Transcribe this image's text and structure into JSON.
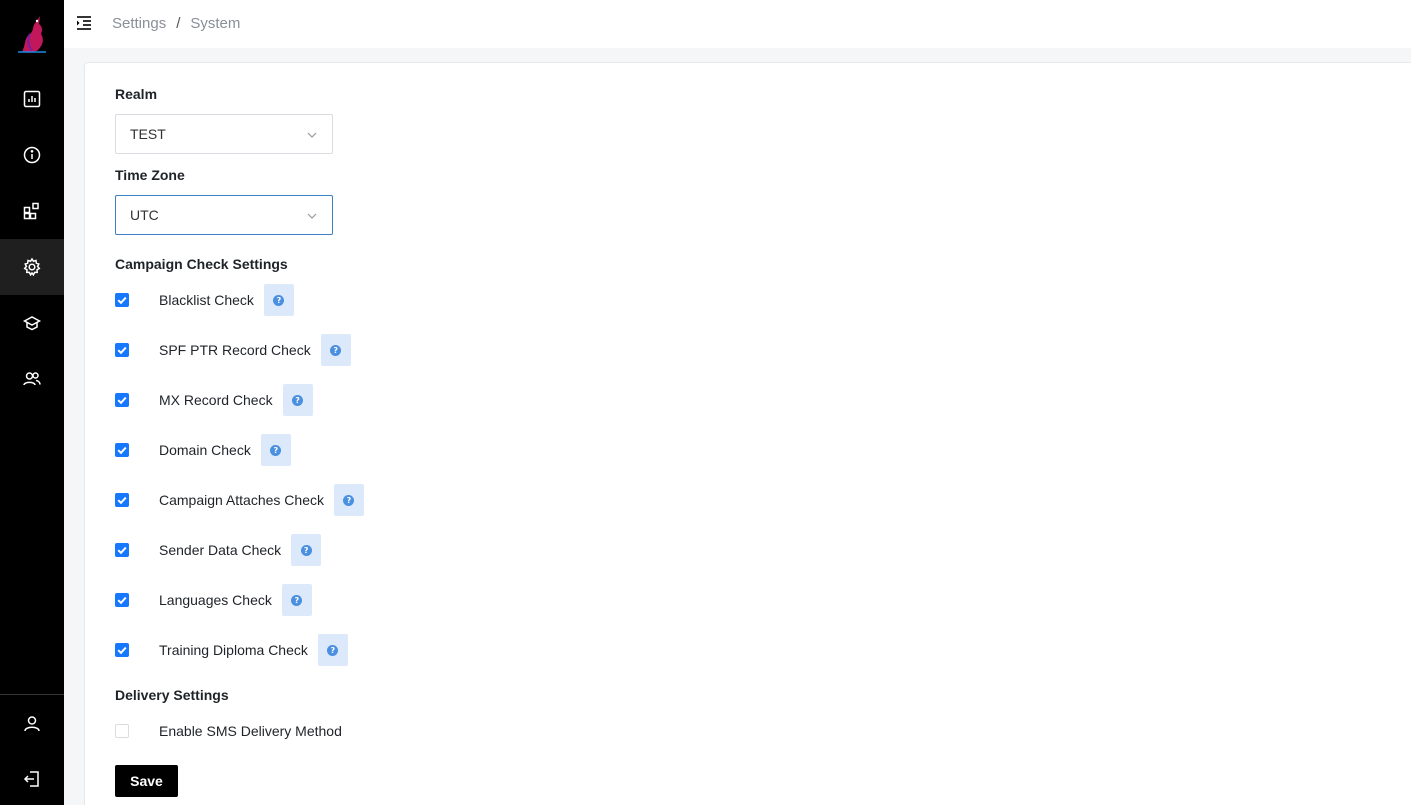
{
  "breadcrumb": {
    "parent": "Settings",
    "separator": "/",
    "current": "System"
  },
  "form": {
    "realm_label": "Realm",
    "realm_value": "TEST",
    "timezone_label": "Time Zone",
    "timezone_value": "UTC",
    "campaign_section_title": "Campaign Check Settings",
    "checks": [
      {
        "label": "Blacklist Check",
        "checked": true
      },
      {
        "label": "SPF PTR Record Check",
        "checked": true
      },
      {
        "label": "MX Record Check",
        "checked": true
      },
      {
        "label": "Domain Check",
        "checked": true
      },
      {
        "label": "Campaign Attaches Check",
        "checked": true
      },
      {
        "label": "Sender Data Check",
        "checked": true
      },
      {
        "label": "Languages Check",
        "checked": true
      },
      {
        "label": "Training Diploma Check",
        "checked": true
      }
    ],
    "delivery_section_title": "Delivery Settings",
    "sms_label": "Enable SMS Delivery Method",
    "sms_checked": false,
    "save_label": "Save"
  },
  "help_glyph": "?",
  "sidebar": {
    "items": [
      "dashboard-icon",
      "info-icon",
      "modules-icon",
      "settings-icon",
      "training-icon",
      "users-icon"
    ],
    "active": "settings-icon",
    "bottom": [
      "profile-icon",
      "logout-icon"
    ]
  },
  "colors": {
    "accent": "#1677ff",
    "sidebar_bg": "#000000",
    "help_bg": "#dbe9fb",
    "save_bg": "#000000"
  }
}
